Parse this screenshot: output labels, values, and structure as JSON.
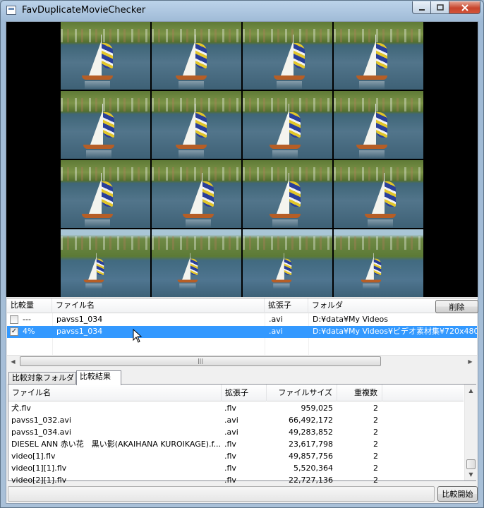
{
  "window": {
    "title": "FavDuplicateMovieChecker",
    "min_icon": "minimize-icon",
    "max_icon": "maximize-icon",
    "close_icon": "close-icon"
  },
  "preview": {
    "description_icon": "movie-thumbnail-grid"
  },
  "match_list": {
    "columns": [
      "比較量",
      "ファイル名",
      "拡張子",
      "フォルダ"
    ],
    "delete_label": "削除",
    "rows": [
      {
        "checked": false,
        "score": "---",
        "name": "pavss1_034",
        "ext": ".avi",
        "folder": "D:¥data¥My Videos"
      },
      {
        "checked": true,
        "score": "4%",
        "name": "pavss1_034",
        "ext": ".avi",
        "folder": "D:¥data¥My Videos¥ビデオ素材集¥720x480"
      }
    ],
    "hscroll_grip": "|||"
  },
  "tabs": [
    {
      "label": "比較対象フォルダ",
      "active": false
    },
    {
      "label": "比較結果",
      "active": true
    }
  ],
  "results": {
    "columns": [
      "ファイル名",
      "拡張子",
      "ファイルサイズ",
      "重複数"
    ],
    "rows": [
      {
        "name": "犬.flv",
        "ext": ".flv",
        "size": "959,025",
        "dup": "2"
      },
      {
        "name": "pavss1_032.avi",
        "ext": ".avi",
        "size": "66,492,172",
        "dup": "2"
      },
      {
        "name": "pavss1_034.avi",
        "ext": ".avi",
        "size": "49,283,852",
        "dup": "2"
      },
      {
        "name": "DIESEL ANN 赤い花　黒い影(AKAIHANA KUROIKAGE).f...",
        "ext": ".flv",
        "size": "23,617,798",
        "dup": "2"
      },
      {
        "name": "video[1].flv",
        "ext": ".flv",
        "size": "49,857,756",
        "dup": "2"
      },
      {
        "name": "video[1][1].flv",
        "ext": ".flv",
        "size": "5,520,364",
        "dup": "2"
      },
      {
        "name": "video[2][1].flv",
        "ext": ".flv",
        "size": "22,727,136",
        "dup": "2"
      }
    ]
  },
  "footer": {
    "start_label": "比較開始"
  }
}
